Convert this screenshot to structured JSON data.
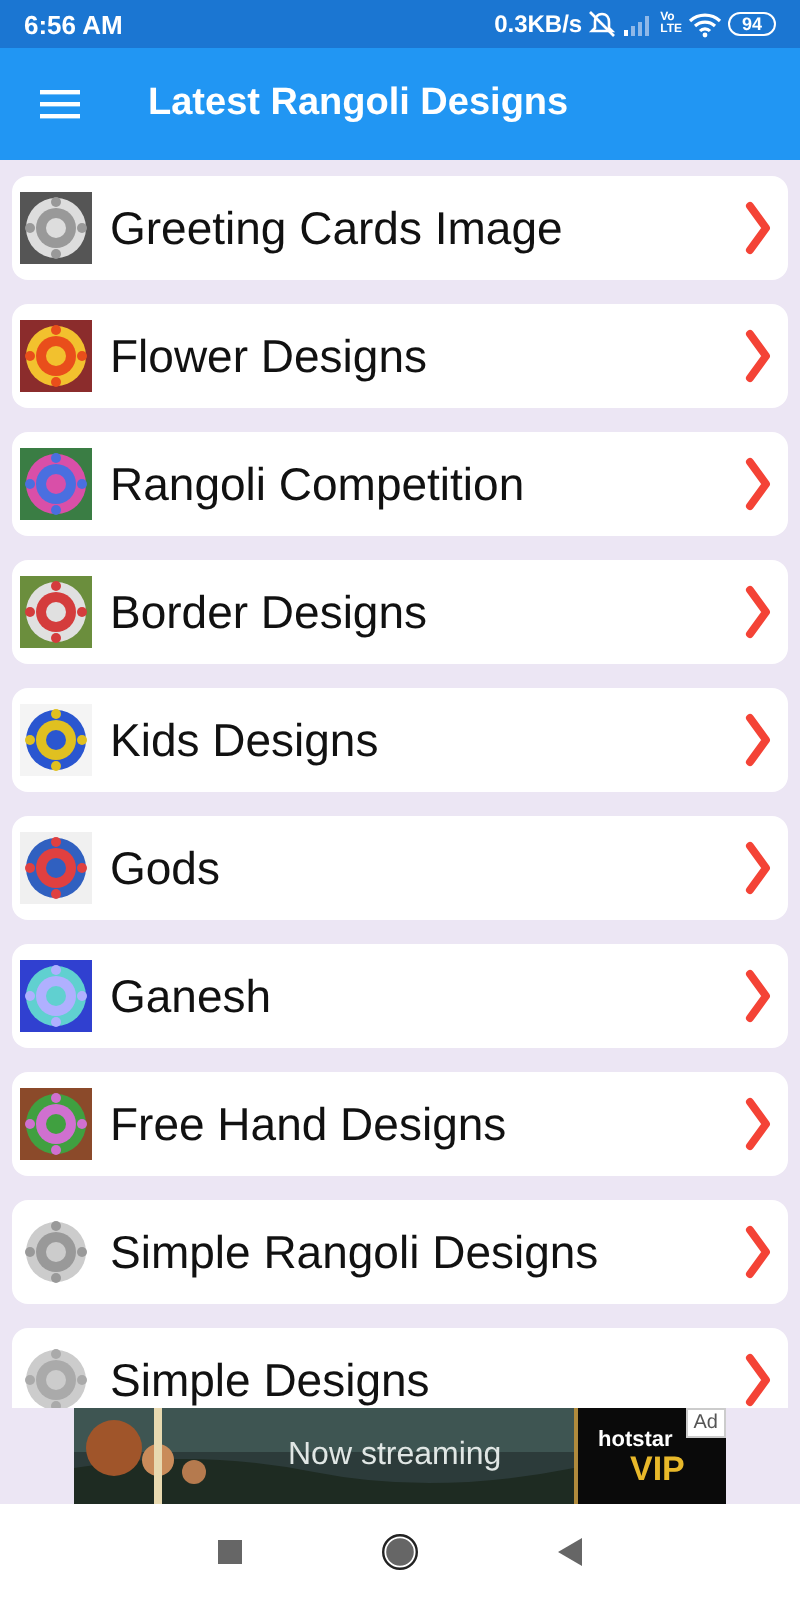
{
  "status_bar": {
    "time": "6:56 AM",
    "speed": "0.3KB/s",
    "network": [
      "Vo",
      "LTE"
    ],
    "battery": "94"
  },
  "app_bar": {
    "title": "Latest Rangoli Designs"
  },
  "items": [
    {
      "label": "Greeting Cards Image"
    },
    {
      "label": "Flower Designs"
    },
    {
      "label": "Rangoli Competition"
    },
    {
      "label": "Border Designs"
    },
    {
      "label": "Kids Designs"
    },
    {
      "label": "Gods"
    },
    {
      "label": "Ganesh"
    },
    {
      "label": "Free Hand Designs"
    },
    {
      "label": "Simple Rangoli Designs"
    },
    {
      "label": "Simple Designs"
    }
  ],
  "ad": {
    "badge": "Ad",
    "headline": "Now streaming",
    "brand": "hotstar",
    "tier": "VIP"
  }
}
